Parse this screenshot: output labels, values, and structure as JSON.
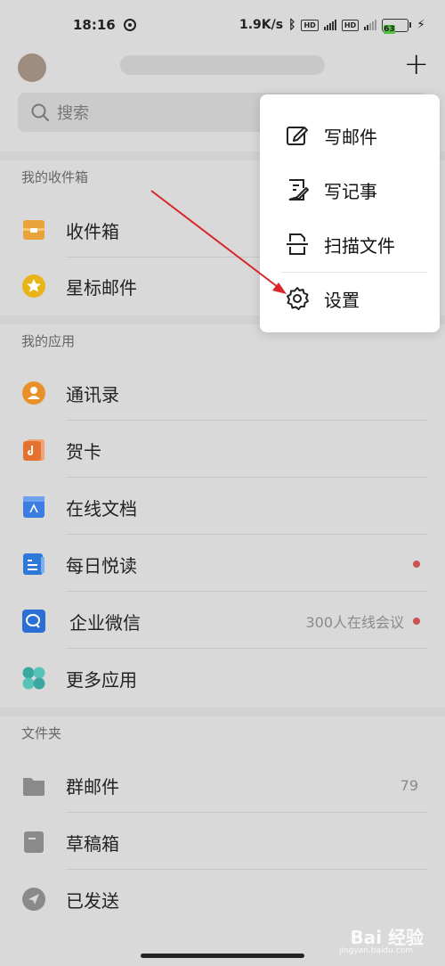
{
  "status_bar": {
    "time": "18:16",
    "speed": "1.9K/s",
    "hd1": "HD",
    "hd2": "HD",
    "battery": "63"
  },
  "search": {
    "placeholder": "搜索"
  },
  "sections": {
    "inbox_title": "我的收件箱",
    "apps_title": "我的应用",
    "folders_title": "文件夹"
  },
  "inbox_items": [
    {
      "label": "收件箱"
    },
    {
      "label": "星标邮件"
    }
  ],
  "app_items": [
    {
      "label": "通讯录"
    },
    {
      "label": "贺卡"
    },
    {
      "label": "在线文档"
    },
    {
      "label": "每日悦读"
    },
    {
      "label": "企业微信",
      "meta": "300人在线会议"
    },
    {
      "label": "更多应用"
    }
  ],
  "folder_items": [
    {
      "label": "群邮件",
      "count": "79"
    },
    {
      "label": "草稿箱"
    },
    {
      "label": "已发送"
    }
  ],
  "popup_menu": [
    {
      "label": "写邮件"
    },
    {
      "label": "写记事"
    },
    {
      "label": "扫描文件"
    },
    {
      "label": "设置"
    }
  ],
  "watermark": {
    "main": "Bai  经验",
    "sub": "jingyan.baidu.com"
  },
  "colors": {
    "inbox": "#e8a33a",
    "star": "#e8b418",
    "contacts": "#e8912a",
    "card": "#e5712f",
    "doc": "#3b7de0",
    "reading": "#2d78d8",
    "wework": "#2b6fd6",
    "dot": "#c95353",
    "arrow": "#d8262a"
  }
}
